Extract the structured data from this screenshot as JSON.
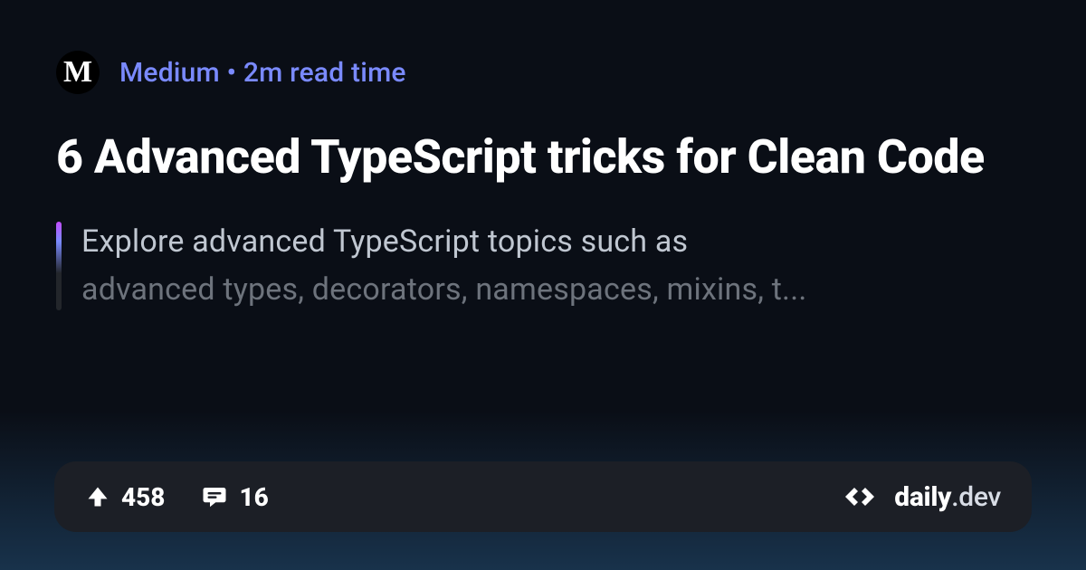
{
  "source": {
    "name": "Medium",
    "icon_letter": "M",
    "read_time": "2m read time",
    "separator": " • "
  },
  "title": "6 Advanced TypeScript tricks for Clean Code",
  "description_line1": "Explore advanced TypeScript topics such as",
  "description_line2": "advanced types, decorators, namespaces, mixins, t...",
  "stats": {
    "upvotes": "458",
    "comments": "16"
  },
  "brand": {
    "name": "daily",
    "suffix": ".dev"
  },
  "colors": {
    "meta": "#7a8aff",
    "accent_top": "#c34cff",
    "bg_card": "#1c1f26"
  }
}
